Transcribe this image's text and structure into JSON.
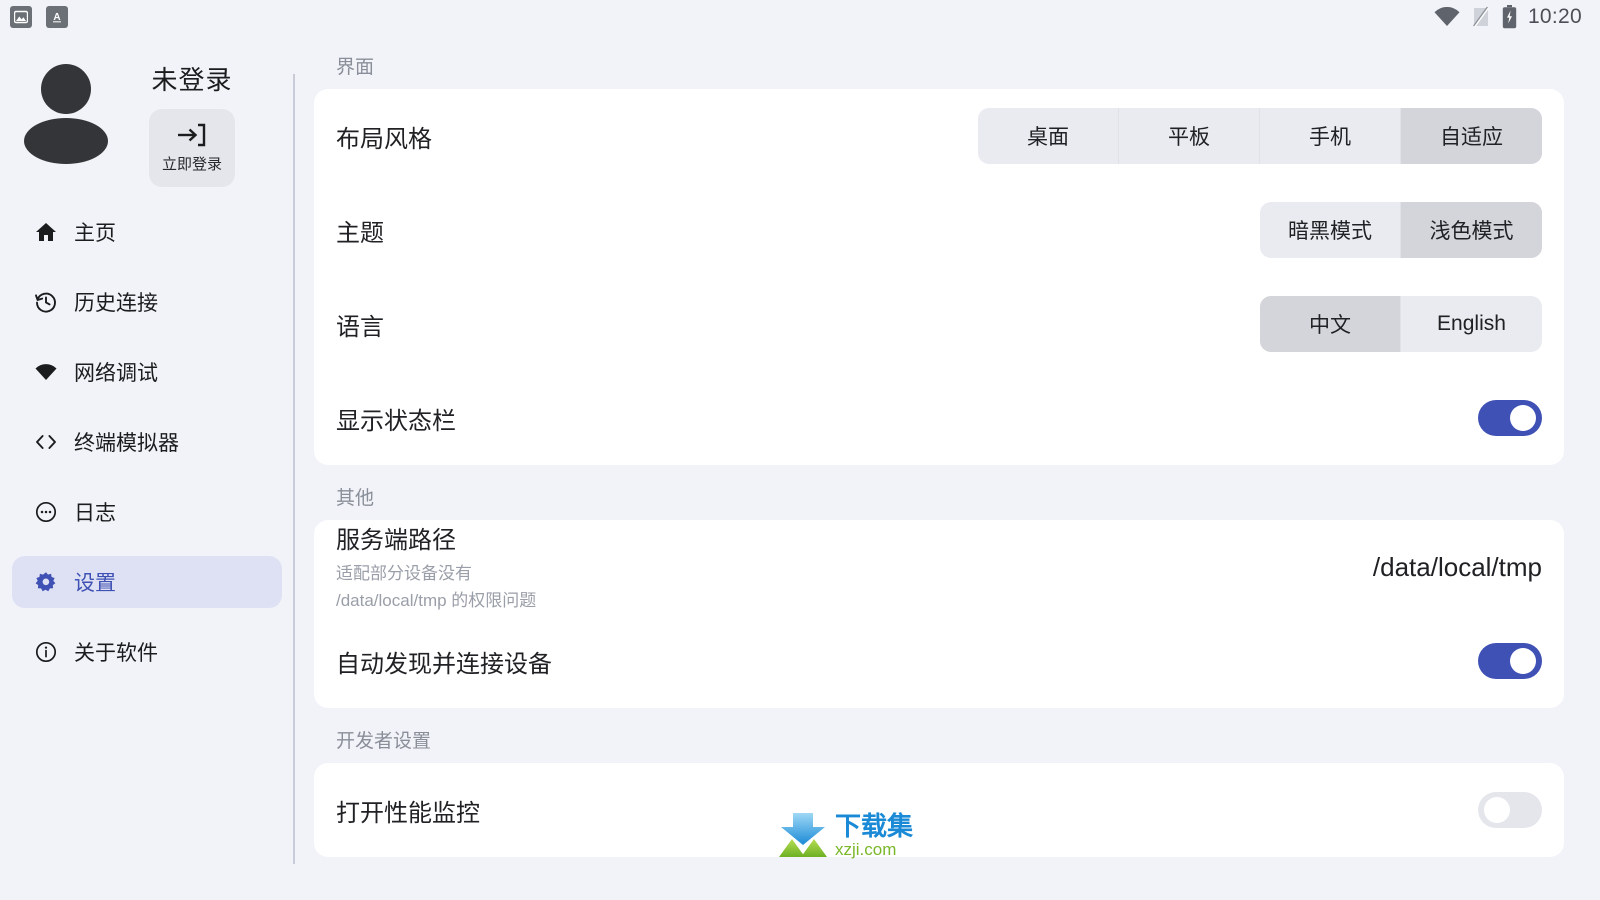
{
  "statusbar": {
    "left_icons": [
      {
        "name": "image-notification-icon",
        "glyph": "▲"
      },
      {
        "name": "keyboard-language-icon",
        "glyph": "A"
      }
    ],
    "wifi_icon": "wifi-icon",
    "signal_icon": "signal-off-icon",
    "battery_icon": "battery-charging-icon",
    "time": "10:20"
  },
  "sidebar": {
    "profile": {
      "name": "未登录",
      "login_label": "立即登录",
      "login_icon": "login-arrow-icon",
      "avatar_icon": "avatar-icon"
    },
    "items": [
      {
        "label": "主页",
        "icon": "home-icon",
        "active": false
      },
      {
        "label": "历史连接",
        "icon": "history-icon",
        "active": false
      },
      {
        "label": "网络调试",
        "icon": "wifi-solid-icon",
        "active": false
      },
      {
        "label": "终端模拟器",
        "icon": "code-brackets-icon",
        "active": false
      },
      {
        "label": "日志",
        "icon": "dots-circle-icon",
        "active": false
      },
      {
        "label": "设置",
        "icon": "gear-icon",
        "active": true
      },
      {
        "label": "关于软件",
        "icon": "info-circle-icon",
        "active": false
      }
    ]
  },
  "sections": [
    {
      "title": "界面",
      "rows": [
        {
          "label": "布局风格",
          "control": "segmented",
          "options": [
            "桌面",
            "平板",
            "手机",
            "自适应"
          ],
          "selected": "自适应"
        },
        {
          "label": "主题",
          "control": "segmented",
          "options": [
            "暗黑模式",
            "浅色模式"
          ],
          "selected": "浅色模式"
        },
        {
          "label": "语言",
          "control": "segmented",
          "options": [
            "中文",
            "English"
          ],
          "selected": "中文"
        },
        {
          "label": "显示状态栏",
          "control": "toggle",
          "on": true
        }
      ]
    },
    {
      "title": "其他",
      "rows": [
        {
          "label": "服务端路径",
          "sub_line1": "适配部分设备没有",
          "sub_line2": "/data/local/tmp 的权限问题",
          "control": "value",
          "value": "/data/local/tmp"
        },
        {
          "label": "自动发现并连接设备",
          "control": "toggle",
          "on": true
        }
      ]
    },
    {
      "title": "开发者设置",
      "rows": [
        {
          "label": "打开性能监控",
          "control": "toggle",
          "on": false
        }
      ]
    }
  ],
  "watermark": {
    "cn": "下载集",
    "en": "xzji.com",
    "icon": "download-arrow-icon"
  },
  "colors": {
    "accent": "#3f51b5",
    "page_bg": "#f1f3f8",
    "card_bg": "#ffffff",
    "seg_bg": "#e9ebf0",
    "seg_selected": "#d3d5da",
    "muted_text": "#8a8e99"
  }
}
